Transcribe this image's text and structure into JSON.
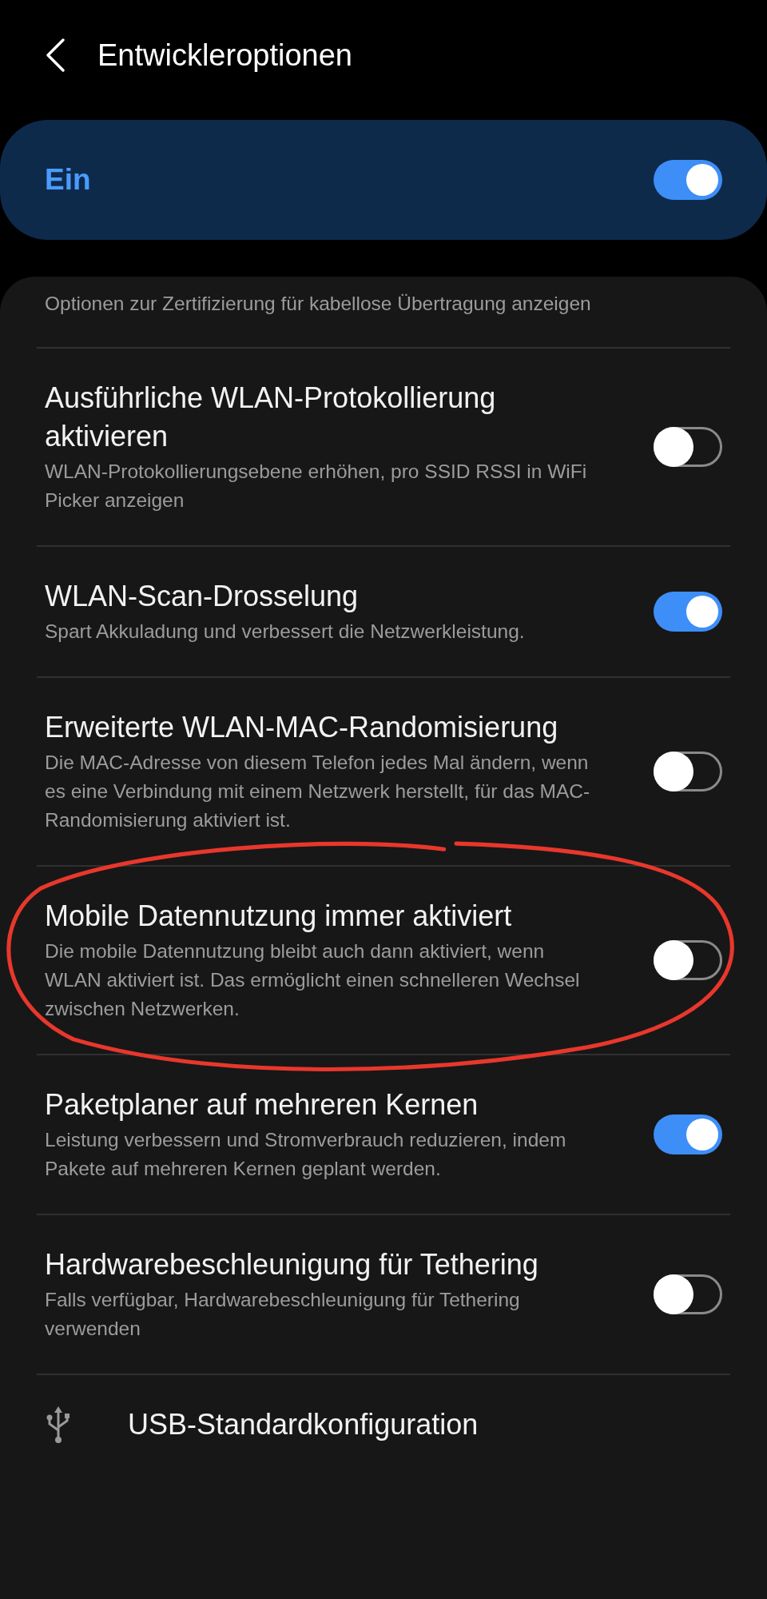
{
  "header": {
    "title": "Entwickleroptionen"
  },
  "master": {
    "label": "Ein",
    "on": true
  },
  "items": [
    {
      "kind": "text",
      "description": "Optionen zur Zertifizierung für kabellose Übertragung anzeigen"
    },
    {
      "kind": "switch",
      "title": "Ausführliche WLAN-Protokollierung aktivieren",
      "description": "WLAN-Protokollierungsebene erhöhen, pro SSID RSSI in WiFi Picker anzeigen",
      "on": false,
      "circled": false
    },
    {
      "kind": "switch",
      "title": "WLAN-Scan-Drosselung",
      "description": "Spart Akkuladung und verbessert die Netzwerkleistung.",
      "on": true,
      "circled": false
    },
    {
      "kind": "switch",
      "title": "Erweiterte WLAN-MAC-Randomisierung",
      "description": "Die MAC-Adresse von diesem Telefon jedes Mal ändern, wenn es eine Verbindung mit einem Netzwerk herstellt, für das MAC-Randomisierung aktiviert ist.",
      "on": false,
      "circled": false
    },
    {
      "kind": "switch",
      "title": "Mobile Datennutzung immer aktiviert",
      "description": "Die mobile Datennutzung bleibt auch dann aktiviert, wenn WLAN aktiviert ist. Das ermöglicht einen schnelleren Wechsel zwischen Netzwerken.",
      "on": false,
      "circled": true
    },
    {
      "kind": "switch",
      "title": "Paketplaner auf mehreren Kernen",
      "description": "Leistung verbessern und Stromverbrauch reduzieren, indem Pakete auf mehreren Kernen geplant werden.",
      "on": true,
      "circled": false
    },
    {
      "kind": "switch",
      "title": "Hardwarebeschleunigung für Tethering",
      "description": "Falls verfügbar, Hardwarebeschleunigung für Tethering verwenden",
      "on": false,
      "circled": false
    },
    {
      "kind": "link",
      "title": "USB-Standardkonfiguration"
    }
  ],
  "annotation": {
    "kind": "ellipse"
  }
}
